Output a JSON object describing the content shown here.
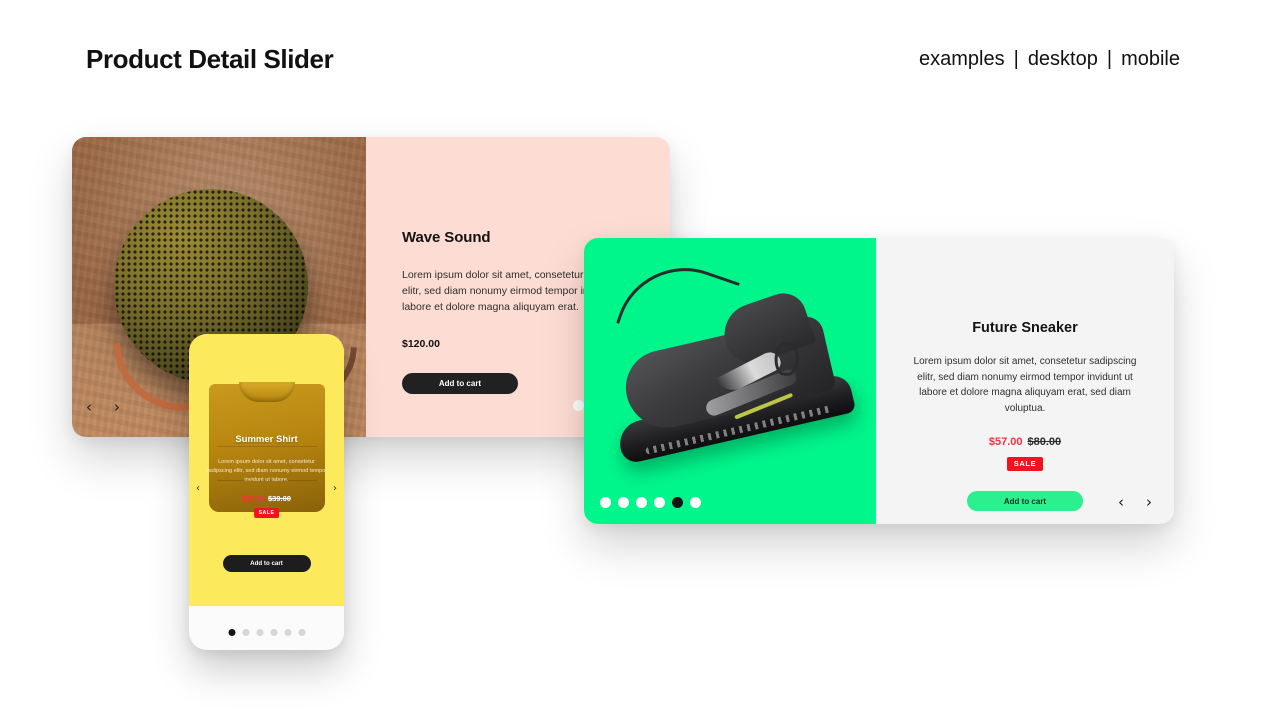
{
  "header": {
    "title": "Product Detail Slider",
    "nav": [
      {
        "label": "examples"
      },
      {
        "label": "desktop"
      },
      {
        "label": "mobile"
      }
    ],
    "separator": "|"
  },
  "cards": {
    "wave": {
      "title": "Wave Sound",
      "description": "Lorem ipsum dolor sit amet, consetetur sadipscing elitr, sed diam nonumy eirmod tempor invidunt ut labore et dolore magna aliquyam erat.",
      "price": "$120.00",
      "cart_label": "Add to cart",
      "prev_icon": "chevron-left",
      "prev_glyph": "‹",
      "next_icon": "chevron-right",
      "next_glyph": "›",
      "dots_total": 4,
      "dots_active": 1,
      "background": "#fdddd3",
      "media_background": "#9b6744",
      "image_subject": "round-mesh-speaker"
    },
    "sneaker": {
      "title": "Future Sneaker",
      "description": "Lorem ipsum dolor sit amet, consetetur sadipscing elitr, sed diam nonumy eirmod tempor invidunt ut labore et dolore magna aliquyam erat, sed diam voluptua.",
      "price_now": "$57.00",
      "price_old": "$80.00",
      "sale_label": "SALE",
      "cart_label": "Add to cart",
      "prev_glyph": "‹",
      "next_glyph": "›",
      "dots_total": 6,
      "dots_active": 5,
      "background": "#f4f4f4",
      "media_background": "#00f58a",
      "accent": "#2cf08f",
      "sale_color": "#f5121f",
      "image_subject": "black-running-sneaker"
    },
    "phone": {
      "title": "Summer Shirt",
      "description": "Lorem ipsum dolor sit amet, consetetur sadipscing elitr, sed diam nonumy eirmod tempor invidunt ut labore.",
      "price_now": "$20.00",
      "price_old": "$39.00",
      "sale_label": "SALE",
      "cart_label": "Add to cart",
      "prev_glyph": "‹",
      "next_glyph": "›",
      "dots_total": 6,
      "dots_active": 1,
      "screen_background": "#fcea5c",
      "image_subject": "folded-mustard-tshirt"
    }
  }
}
